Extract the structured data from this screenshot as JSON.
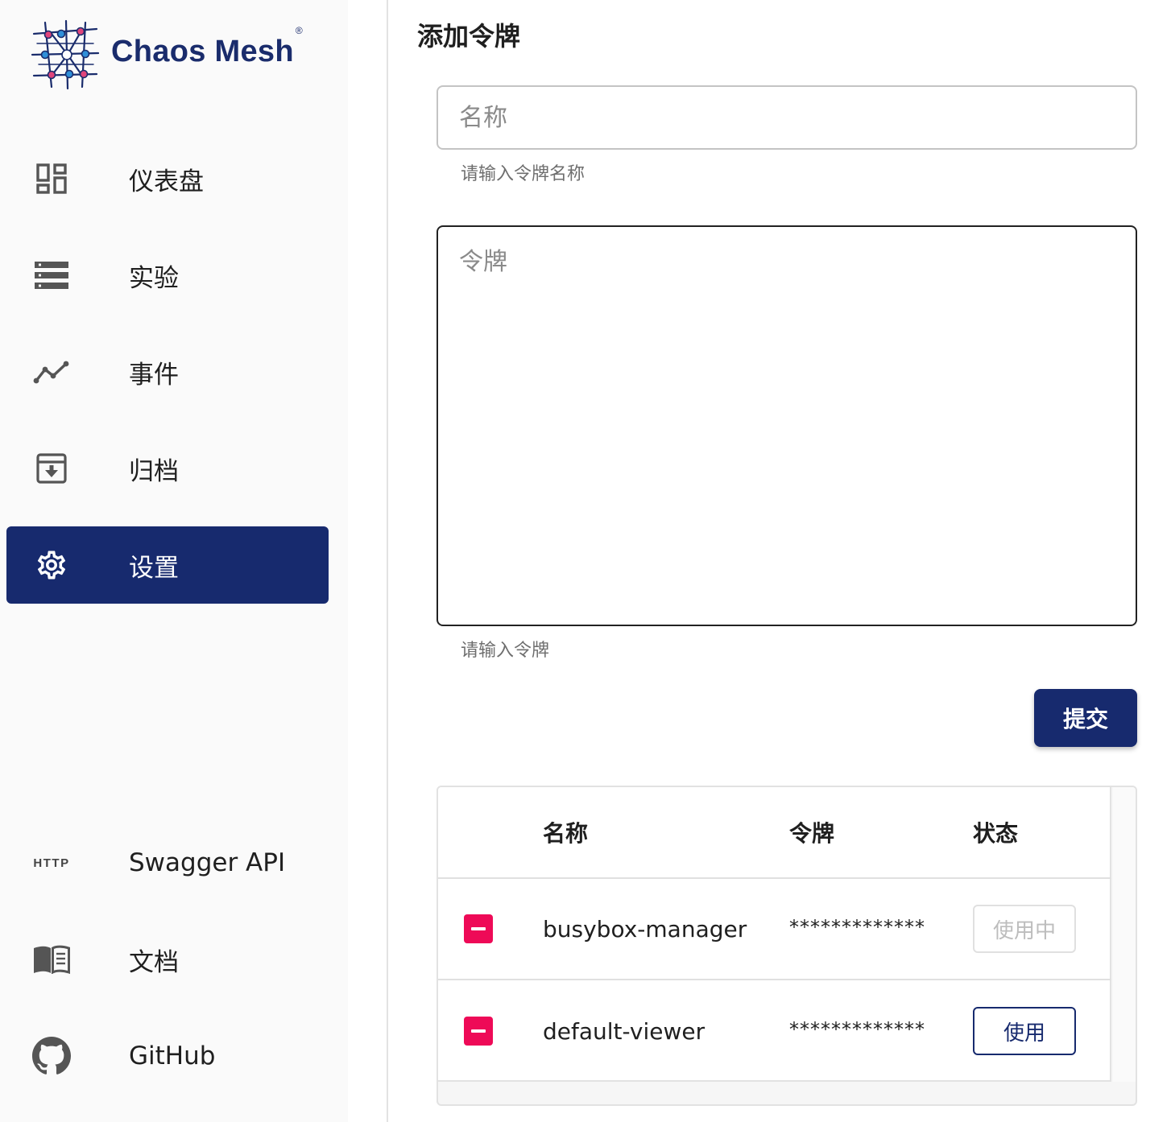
{
  "brand": {
    "name": "Chaos Mesh",
    "reg": "®"
  },
  "sidebar": {
    "items": [
      {
        "label": "仪表盘",
        "icon": "dashboard-icon"
      },
      {
        "label": "实验",
        "icon": "experiments-list-icon"
      },
      {
        "label": "事件",
        "icon": "events-chart-icon"
      },
      {
        "label": "归档",
        "icon": "archive-icon"
      },
      {
        "label": "设置",
        "icon": "settings-gear-icon",
        "active": true
      }
    ],
    "bottom_items": [
      {
        "label": "Swagger API",
        "icon": "http-icon",
        "badge": "HTTP"
      },
      {
        "label": "文档",
        "icon": "book-icon"
      },
      {
        "label": "GitHub",
        "icon": "github-icon"
      }
    ]
  },
  "main": {
    "title": "添加令牌",
    "name_field": {
      "placeholder": "名称",
      "helper": "请输入令牌名称"
    },
    "token_field": {
      "placeholder": "令牌",
      "helper": "请输入令牌"
    },
    "submit_label": "提交",
    "table": {
      "headers": [
        "名称",
        "令牌",
        "状态"
      ],
      "rows": [
        {
          "name": "busybox-manager",
          "token": "*************",
          "status": "使用中",
          "status_disabled": true
        },
        {
          "name": "default-viewer",
          "token": "*************",
          "status": "使用",
          "status_disabled": false
        }
      ]
    }
  },
  "colors": {
    "accent": "#172a6e",
    "danger": "#ee0a57",
    "sidebar_bg": "#fafafa"
  }
}
